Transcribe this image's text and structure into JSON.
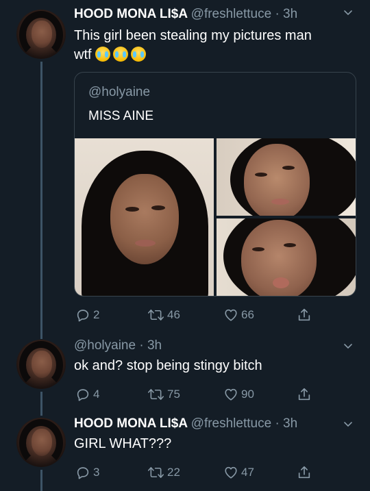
{
  "tweets": [
    {
      "name": "HOOD MONA LI$A",
      "handle": "@freshlettuce · 3h",
      "text_line1": "This girl been stealing my pictures man",
      "text_line2": "wtf",
      "emojis": [
        "loudly-crying-face",
        "loudly-crying-face",
        "loudly-crying-face"
      ],
      "quoted": {
        "handle": "@holyaine",
        "text": "MISS AINE"
      },
      "actions": {
        "replies": "2",
        "retweets": "46",
        "likes": "66"
      }
    },
    {
      "handle": "@holyaine · 3h",
      "text": "ok and? stop being stingy bitch",
      "actions": {
        "replies": "4",
        "retweets": "75",
        "likes": "90"
      }
    },
    {
      "name": "HOOD MONA LI$A",
      "handle": "@freshlettuce · 3h",
      "text": "GIRL WHAT???",
      "actions": {
        "replies": "3",
        "retweets": "22",
        "likes": "47"
      }
    }
  ],
  "icons": {
    "reply": "reply-icon",
    "retweet": "retweet-icon",
    "like": "heart-icon",
    "share": "share-icon",
    "more": "chevron-down-icon"
  },
  "colors": {
    "background": "#141d26",
    "muted": "#8899a6",
    "thread_line": "#3d5466",
    "card_border": "#38444d"
  }
}
